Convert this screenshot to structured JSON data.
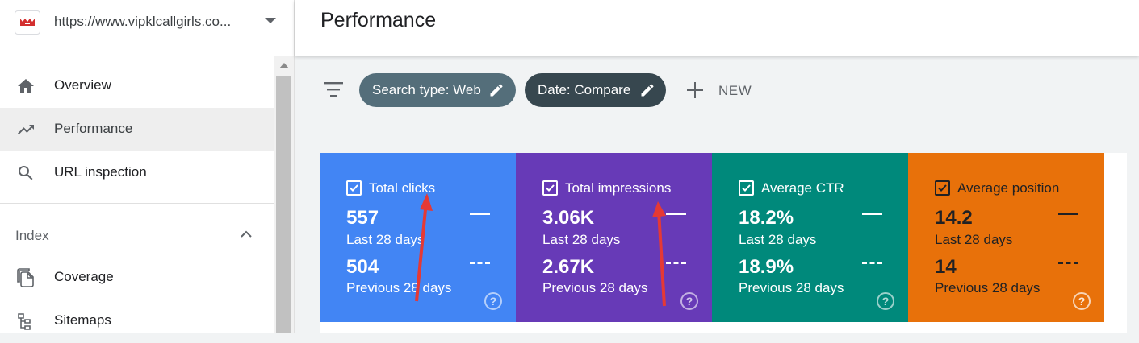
{
  "property": {
    "url": "https://www.vipklcallgirls.co...",
    "logo_icon": "site-favicon-icon",
    "dropdown_icon": "caret-down-icon"
  },
  "sidebar": {
    "items": [
      {
        "label": "Overview",
        "icon": "home-icon"
      },
      {
        "label": "Performance",
        "icon": "trending-up-icon",
        "active": true
      },
      {
        "label": "URL inspection",
        "icon": "search-icon"
      }
    ],
    "section": {
      "label": "Index",
      "icon": "chevron-up-icon"
    },
    "index_items": [
      {
        "label": "Coverage",
        "icon": "pages-copy-icon"
      },
      {
        "label": "Sitemaps",
        "icon": "sitemap-icon"
      }
    ]
  },
  "header": {
    "title": "Performance"
  },
  "filters": {
    "filter_icon": "filter-list-icon",
    "chips": [
      {
        "label": "Search type: Web",
        "icon": "edit-icon",
        "color": "#546e7a"
      },
      {
        "label": "Date: Compare",
        "icon": "edit-icon",
        "color": "#37474f"
      }
    ],
    "new_label": "NEW",
    "new_icon": "plus-icon"
  },
  "metrics": [
    {
      "name": "Total clicks",
      "current": "557",
      "current_label": "Last 28 days",
      "previous": "504",
      "previous_label": "Previous 28 days",
      "color": "#4285f4",
      "checked": true
    },
    {
      "name": "Total impressions",
      "current": "3.06K",
      "current_label": "Last 28 days",
      "previous": "2.67K",
      "previous_label": "Previous 28 days",
      "color": "#673ab7",
      "checked": true
    },
    {
      "name": "Average CTR",
      "current": "18.2%",
      "current_label": "Last 28 days",
      "previous": "18.9%",
      "previous_label": "Previous 28 days",
      "color": "#00897b",
      "checked": true
    },
    {
      "name": "Average position",
      "current": "14.2",
      "current_label": "Last 28 days",
      "previous": "14",
      "previous_label": "Previous 28 days",
      "color": "#e8710a",
      "checked": true
    }
  ],
  "help_glyph": "?",
  "annotation_color": "#e53935"
}
